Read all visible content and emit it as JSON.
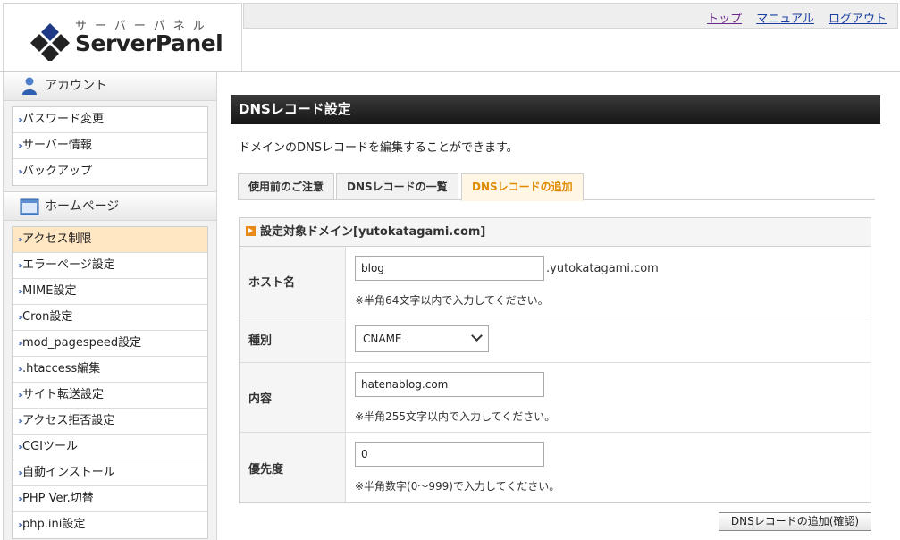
{
  "header": {
    "logo_kana": "サーバーパネル",
    "logo_text": "ServerPanel",
    "links": {
      "top": "トップ",
      "manual": "マニュアル",
      "logout": "ログアウト"
    }
  },
  "sidebar": {
    "sections": [
      {
        "title": "アカウント",
        "icon": "user-icon",
        "items": [
          "パスワード変更",
          "サーバー情報",
          "バックアップ"
        ]
      },
      {
        "title": "ホームページ",
        "icon": "window-icon",
        "items": [
          "アクセス制限",
          "エラーページ設定",
          "MIME設定",
          "Cron設定",
          "mod_pagespeed設定",
          ".htaccess編集",
          "サイト転送設定",
          "アクセス拒否設定",
          "CGIツール",
          "自動インストール",
          "PHP Ver.切替",
          "php.ini設定"
        ],
        "active_item": "アクセス制限"
      }
    ]
  },
  "main": {
    "title": "DNSレコード設定",
    "description": "ドメインのDNSレコードを編集することができます。",
    "tabs": [
      "使用前のご注意",
      "DNSレコードの一覧",
      "DNSレコードの追加"
    ],
    "active_tab": "DNSレコードの追加",
    "form": {
      "heading": "設定対象ドメイン[yutokatagami.com]",
      "host": {
        "label": "ホスト名",
        "value": "blog",
        "suffix": ".yutokatagami.com",
        "note": "※半角64文字以内で入力してください。"
      },
      "type": {
        "label": "種別",
        "value": "CNAME"
      },
      "content": {
        "label": "内容",
        "value": "hatenablog.com",
        "note": "※半角255文字以内で入力してください。"
      },
      "priority": {
        "label": "優先度",
        "value": "0",
        "note": "※半角数字(0～999)で入力してください。"
      }
    },
    "submit_label": "DNSレコードの追加(確認)"
  },
  "colors": {
    "accent": "#e08a00",
    "active_menu_bg": "#ffe7c4",
    "title_bar": "#1e1e1e",
    "link": "#1a3fa0"
  }
}
